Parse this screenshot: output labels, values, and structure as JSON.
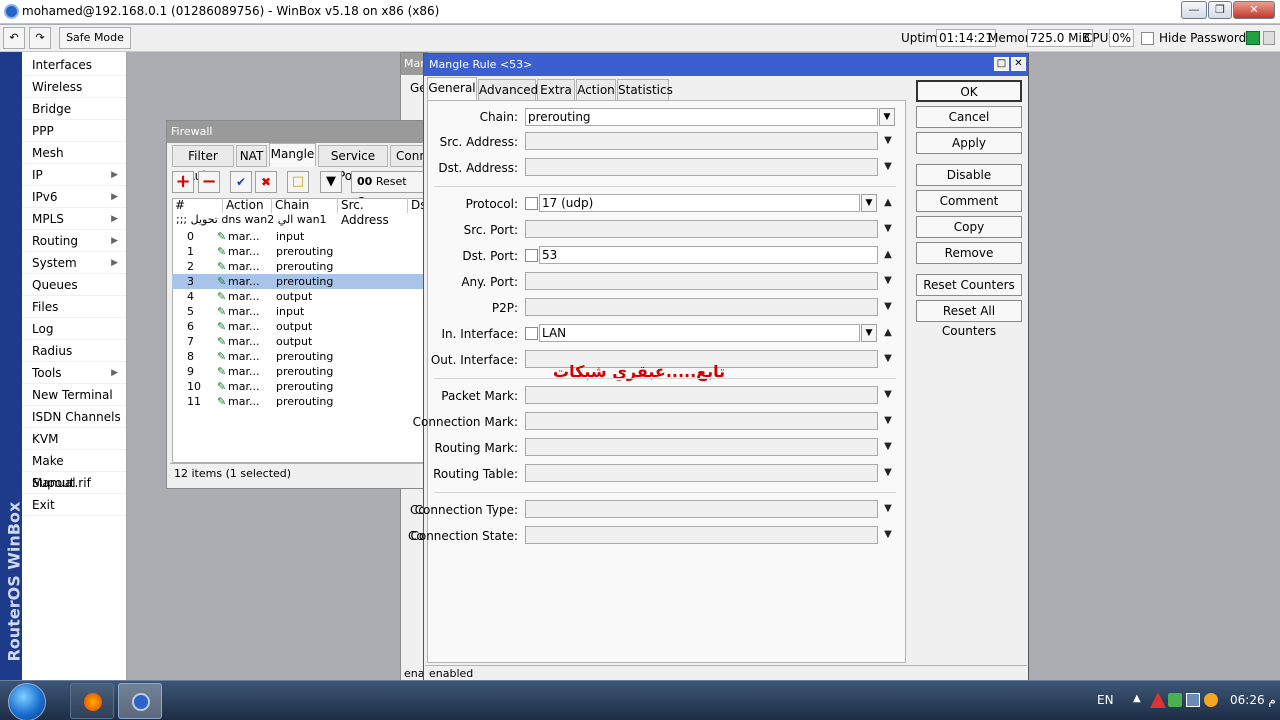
{
  "title_bar": {
    "text": "mohamed@192.168.0.1 (01286089756) - WinBox v5.18 on x86 (x86)"
  },
  "toolbar": {
    "safe_mode": "Safe Mode",
    "uptime_label": "Uptime:",
    "uptime": "01:14:21",
    "memory_label": "Memory:",
    "memory": "725.0 MiB",
    "cpu_label": "CPU:",
    "cpu": "0%",
    "hide_passwords": "Hide Passwords"
  },
  "brand": "RouterOS WinBox",
  "menu": [
    {
      "label": "Interfaces",
      "sub": false
    },
    {
      "label": "Wireless",
      "sub": false
    },
    {
      "label": "Bridge",
      "sub": false
    },
    {
      "label": "PPP",
      "sub": false
    },
    {
      "label": "Mesh",
      "sub": false
    },
    {
      "label": "IP",
      "sub": true
    },
    {
      "label": "IPv6",
      "sub": true
    },
    {
      "label": "MPLS",
      "sub": true
    },
    {
      "label": "Routing",
      "sub": true
    },
    {
      "label": "System",
      "sub": true
    },
    {
      "label": "Queues",
      "sub": false
    },
    {
      "label": "Files",
      "sub": false
    },
    {
      "label": "Log",
      "sub": false
    },
    {
      "label": "Radius",
      "sub": false
    },
    {
      "label": "Tools",
      "sub": true
    },
    {
      "label": "New Terminal",
      "sub": false
    },
    {
      "label": "ISDN Channels",
      "sub": false
    },
    {
      "label": "KVM",
      "sub": false
    },
    {
      "label": "Make Supout.rif",
      "sub": false
    },
    {
      "label": "Manual",
      "sub": false
    },
    {
      "label": "Exit",
      "sub": false
    }
  ],
  "firewall": {
    "title": "Firewall",
    "tabs": [
      "Filter Rules",
      "NAT",
      "Mangle",
      "Service Ports",
      "Conn"
    ],
    "reset_counters": "Reset Cou",
    "columns": [
      "#",
      "Action",
      "Chain",
      "Src. Address",
      "Ds"
    ],
    "comment": ";;; تحويل dns wan2 الي wan1",
    "rows": [
      {
        "n": "0",
        "action": "mar...",
        "chain": "input"
      },
      {
        "n": "1",
        "action": "mar...",
        "chain": "prerouting"
      },
      {
        "n": "2",
        "action": "mar...",
        "chain": "prerouting"
      },
      {
        "n": "3",
        "action": "mar...",
        "chain": "prerouting"
      },
      {
        "n": "4",
        "action": "mar...",
        "chain": "output"
      },
      {
        "n": "5",
        "action": "mar...",
        "chain": "input"
      },
      {
        "n": "6",
        "action": "mar...",
        "chain": "output"
      },
      {
        "n": "7",
        "action": "mar...",
        "chain": "output"
      },
      {
        "n": "8",
        "action": "mar...",
        "chain": "prerouting"
      },
      {
        "n": "9",
        "action": "mar...",
        "chain": "prerouting"
      },
      {
        "n": "10",
        "action": "mar...",
        "chain": "prerouting"
      },
      {
        "n": "11",
        "action": "mar...",
        "chain": "prerouting"
      }
    ],
    "selected_row": "3",
    "status": "12 items (1 selected)"
  },
  "back_window": {
    "title": "Mar",
    "tab": "Ge",
    "row_a": "Co",
    "row_b": "Co",
    "status": "ena"
  },
  "mangle": {
    "title": "Mangle Rule <53>",
    "tabs": [
      "General",
      "Advanced",
      "Extra",
      "Action",
      "Statistics"
    ],
    "fields": {
      "chain": {
        "label": "Chain:",
        "value": "prerouting"
      },
      "src_address": {
        "label": "Src. Address:",
        "value": ""
      },
      "dst_address": {
        "label": "Dst. Address:",
        "value": ""
      },
      "protocol": {
        "label": "Protocol:",
        "value": "17 (udp)"
      },
      "src_port": {
        "label": "Src. Port:",
        "value": ""
      },
      "dst_port": {
        "label": "Dst. Port:",
        "value": "53"
      },
      "any_port": {
        "label": "Any. Port:",
        "value": ""
      },
      "p2p": {
        "label": "P2P:",
        "value": ""
      },
      "in_interface": {
        "label": "In. Interface:",
        "value": "LAN"
      },
      "out_interface": {
        "label": "Out. Interface:",
        "value": ""
      },
      "packet_mark": {
        "label": "Packet Mark:",
        "value": ""
      },
      "connection_mark": {
        "label": "Connection Mark:",
        "value": ""
      },
      "routing_mark": {
        "label": "Routing Mark:",
        "value": ""
      },
      "routing_table": {
        "label": "Routing Table:",
        "value": ""
      },
      "connection_type": {
        "label": "Connection Type:",
        "value": ""
      },
      "connection_state": {
        "label": "Connection State:",
        "value": ""
      }
    },
    "buttons": {
      "ok": "OK",
      "cancel": "Cancel",
      "apply": "Apply",
      "disable": "Disable",
      "comment": "Comment",
      "copy": "Copy",
      "remove": "Remove",
      "reset_counters": "Reset Counters",
      "reset_all": "Reset All Counters"
    },
    "status": "enabled"
  },
  "watermark": "تابع.....عبقري شبكات",
  "taskbar": {
    "lang": "EN",
    "time": "06:26 م"
  },
  "colors": {
    "menu_strip": "#1e3a8a",
    "dialog_title": "#3b5fd0",
    "selection": "#a8c4e8",
    "watermark": "#d40000"
  }
}
